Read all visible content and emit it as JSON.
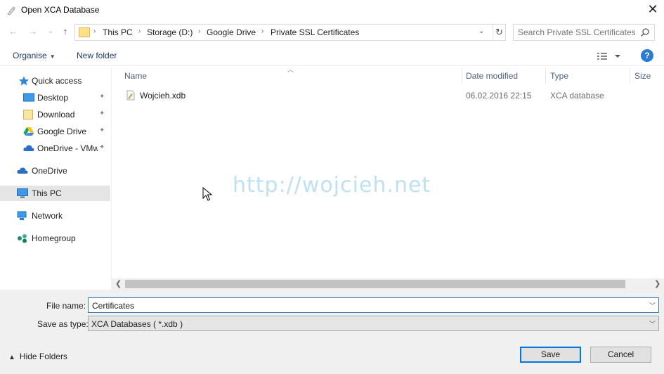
{
  "window": {
    "title": "Open XCA Database",
    "close_glyph": "✕"
  },
  "nav": {
    "back_glyph": "←",
    "forward_glyph": "→",
    "recent_glyph": "⌄",
    "up_glyph": "↑",
    "breadcrumbs": [
      "This PC",
      "Storage (D:)",
      "Google Drive",
      "Private SSL Certificates"
    ],
    "crumb_sep": "›",
    "dropdown_glyph": "⌄",
    "refresh_glyph": "↻",
    "search_placeholder": "Search Private SSL Certificates"
  },
  "toolbar": {
    "organise_label": "Organise",
    "new_folder_label": "New folder",
    "help_glyph": "?"
  },
  "sidebar": {
    "quick_access": "Quick access",
    "desktop": "Desktop",
    "download": "Download",
    "google_drive": "Google Drive",
    "onedrive_vmw": "OneDrive - VMw",
    "onedrive": "OneDrive",
    "this_pc": "This PC",
    "network": "Network",
    "homegroup": "Homegroup",
    "pin_glyph": "📌"
  },
  "columns": {
    "name": "Name",
    "date_modified": "Date modified",
    "type": "Type",
    "size": "Size"
  },
  "files": [
    {
      "name": "Wojcieh.xdb",
      "date_modified": "06.02.2016 22:15",
      "type": "XCA database"
    }
  ],
  "watermark": "http://wojcieh.net",
  "form": {
    "file_name_label": "File name:",
    "file_name_value": "Certificates",
    "save_as_type_label": "Save as type:",
    "save_as_type_value": "XCA Databases ( *.xdb )"
  },
  "footer": {
    "hide_folders_label": "Hide Folders",
    "save_label": "Save",
    "cancel_label": "Cancel"
  },
  "colors": {
    "accent": "#0078d7",
    "selection": "#e5e5e5",
    "watermark": "#bfe0f2"
  }
}
